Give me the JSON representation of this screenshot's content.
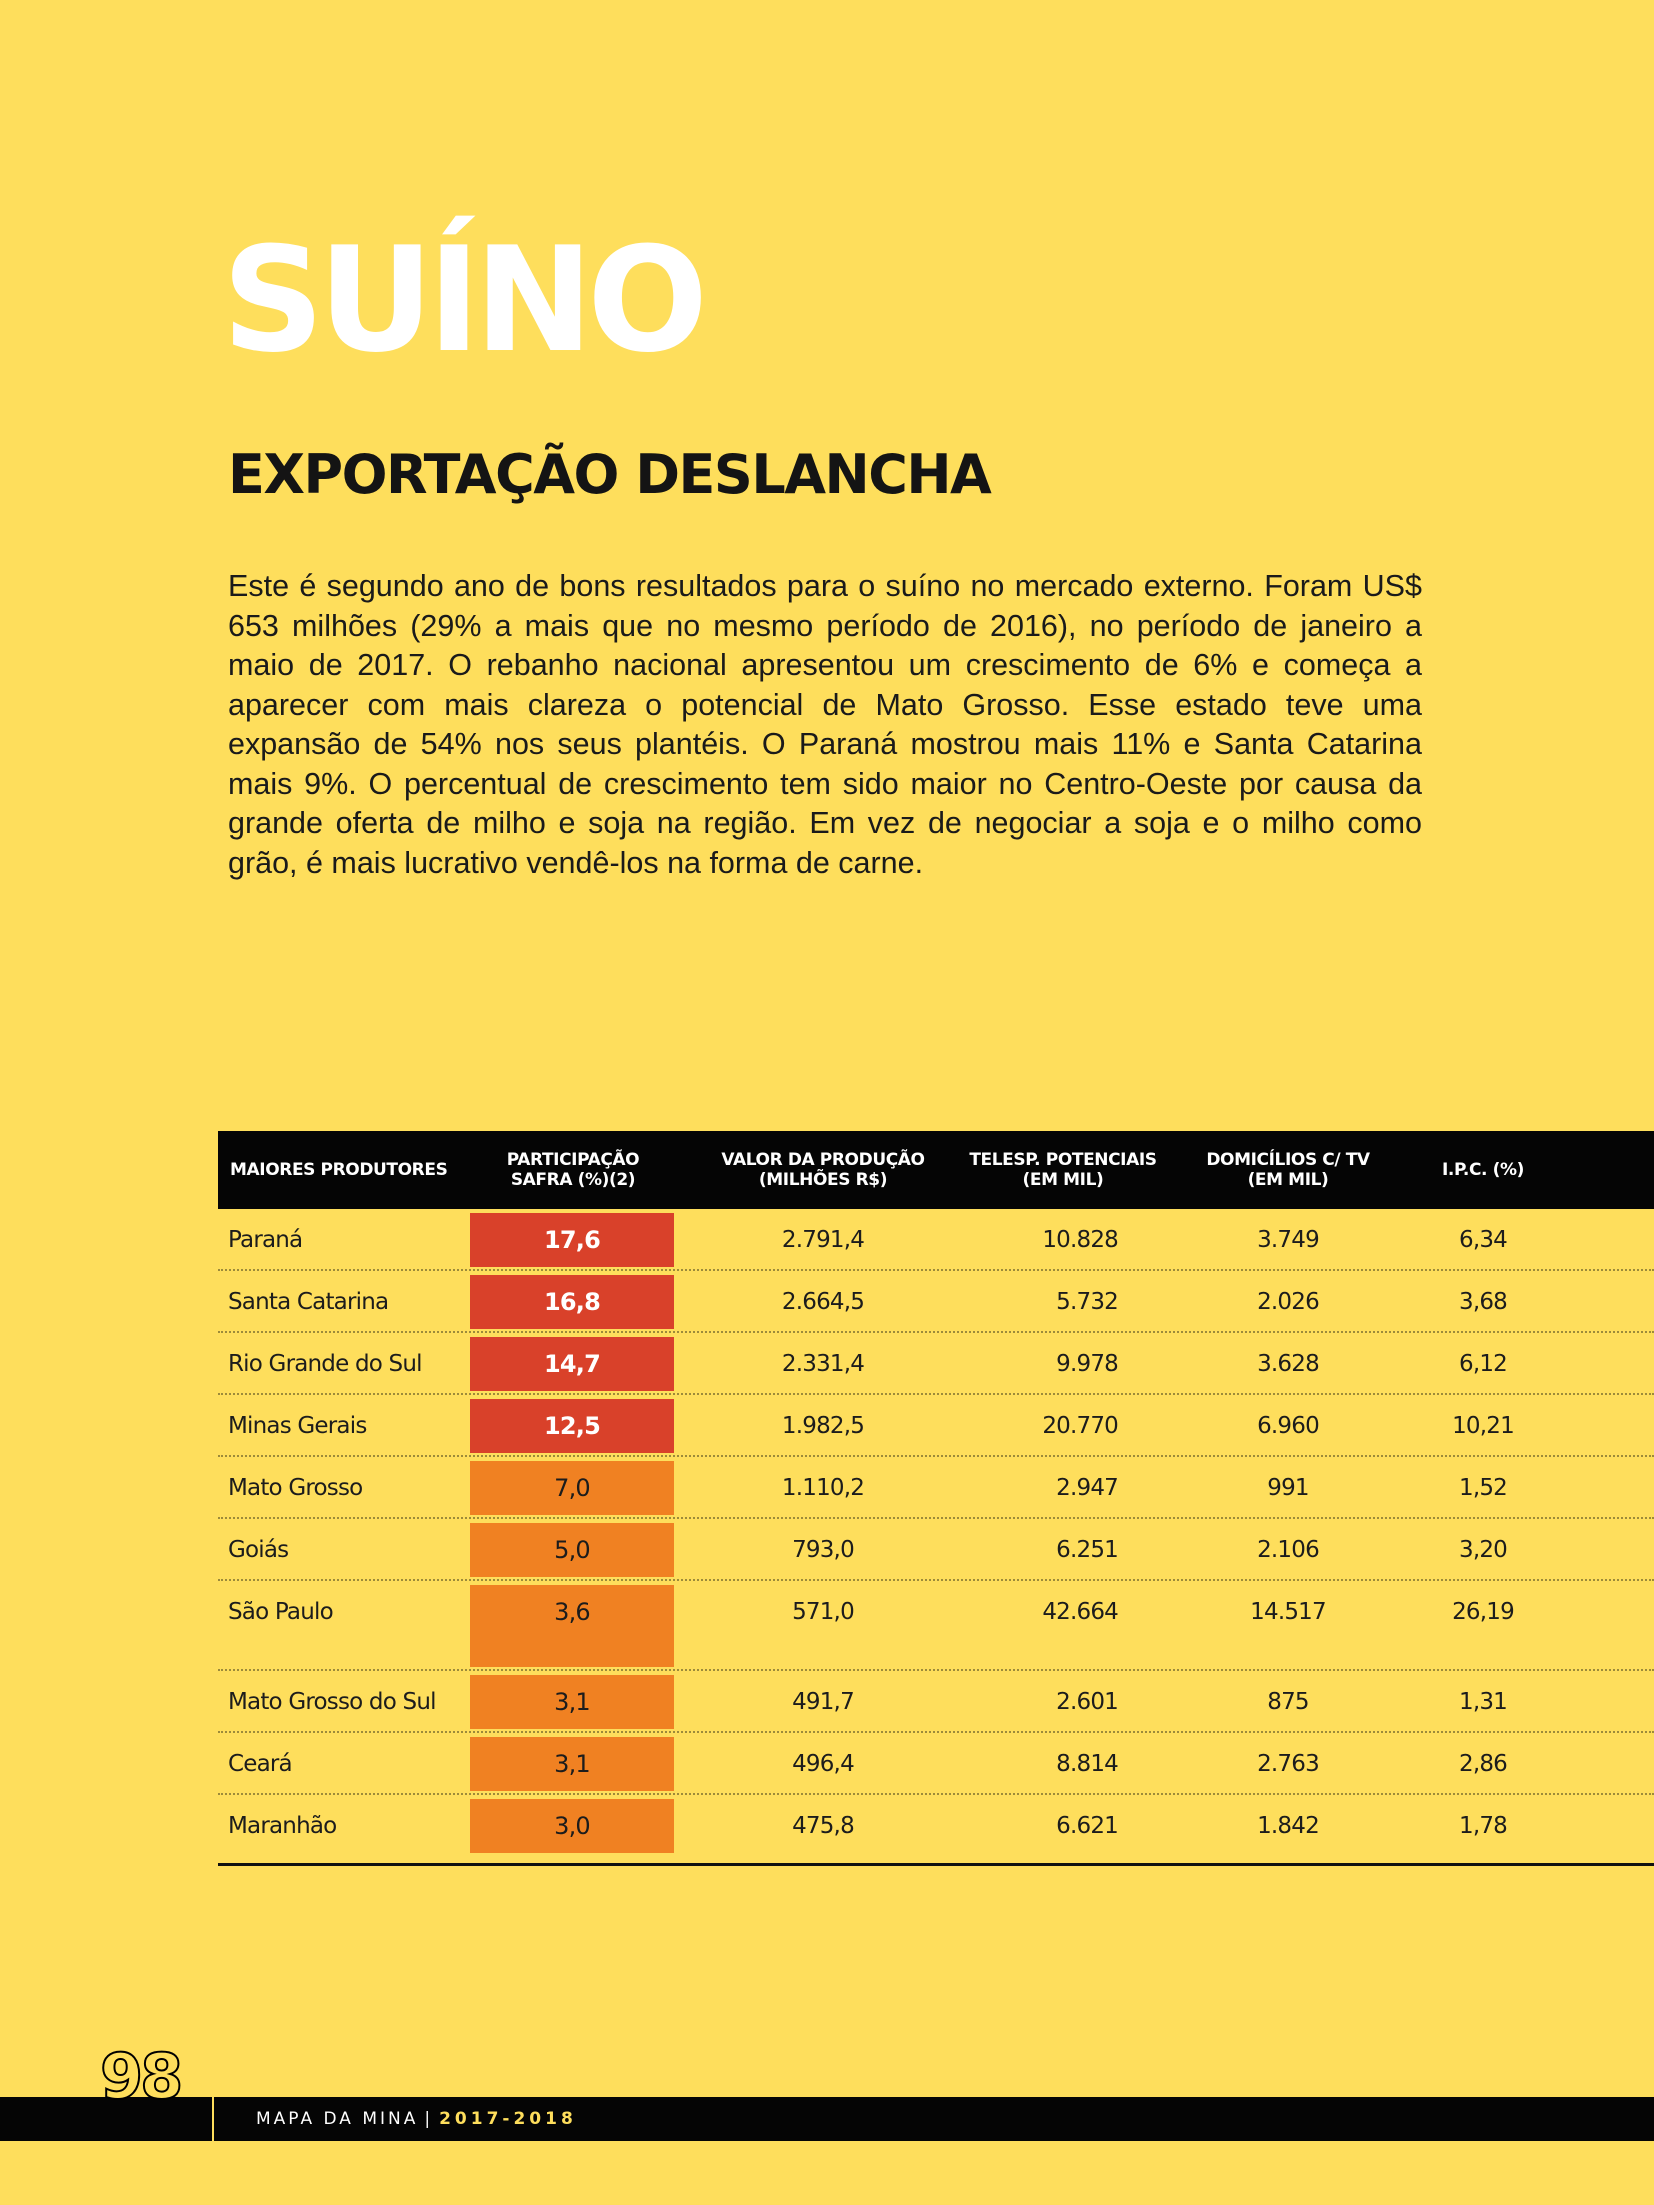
{
  "title": "SUÍNO",
  "subtitle": "EXPORTAÇÃO DESLANCHA",
  "body": "Este é segundo ano de bons resultados para o suíno no mercado externo. Foram US$ 653 milhões (29% a mais que no mesmo período de 2016), no período de janeiro a maio de 2017. O rebanho nacional apresentou um crescimento de 6% e começa a aparecer com mais clareza o potencial de Mato Grosso. Esse estado teve uma expansão de 54% nos seus plantéis. O Paraná mostrou mais 11% e Santa Catarina mais 9%. O percentual de crescimento tem sido maior no Centro-Oeste por causa da grande oferta de milho e soja na região. Em vez de negociar a soja e o milho como grão, é mais lucrativo vendê-los na forma de carne.",
  "table": {
    "headers": [
      "MAIORES PRODUTORES",
      "PARTICIPAÇÃO\nSAFRA (%)(2)",
      "VALOR DA PRODUÇÃO\n(MILHÕES R$)",
      "TELESP. POTENCIAIS\n(EM MIL)",
      "DOMICÍLIOS C/ TV\n(EM MIL)",
      "I.P.C. (%)"
    ],
    "rows": [
      {
        "state": "Paraná",
        "share": "17,6",
        "value": "2.791,4",
        "telesp": "10.828",
        "tv": "3.749",
        "ipc": "6,34",
        "tier": "red"
      },
      {
        "state": "Santa Catarina",
        "share": "16,8",
        "value": "2.664,5",
        "telesp": "5.732",
        "tv": "2.026",
        "ipc": "3,68",
        "tier": "red"
      },
      {
        "state": "Rio Grande do Sul",
        "share": "14,7",
        "value": "2.331,4",
        "telesp": "9.978",
        "tv": "3.628",
        "ipc": "6,12",
        "tier": "red"
      },
      {
        "state": "Minas Gerais",
        "share": "12,5",
        "value": "1.982,5",
        "telesp": "20.770",
        "tv": "6.960",
        "ipc": "10,21",
        "tier": "red"
      },
      {
        "state": "Mato Grosso",
        "share": "7,0",
        "value": "1.110,2",
        "telesp": "2.947",
        "tv": "991",
        "ipc": "1,52",
        "tier": "orange"
      },
      {
        "state": "Goiás",
        "share": "5,0",
        "value": "793,0",
        "telesp": "6.251",
        "tv": "2.106",
        "ipc": "3,20",
        "tier": "orange"
      },
      {
        "state": "São Paulo",
        "share": "3,6",
        "value": "571,0",
        "telesp": "42.664",
        "tv": "14.517",
        "ipc": "26,19",
        "tier": "orange"
      },
      {
        "state": "Mato Grosso do Sul",
        "share": "3,1",
        "value": "491,7",
        "telesp": "2.601",
        "tv": "875",
        "ipc": "1,31",
        "tier": "orange"
      },
      {
        "state": "Ceará",
        "share": "3,1",
        "value": "496,4",
        "telesp": "8.814",
        "tv": "2.763",
        "ipc": "2,86",
        "tier": "orange"
      },
      {
        "state": "Maranhão",
        "share": "3,0",
        "value": "475,8",
        "telesp": "6.621",
        "tv": "1.842",
        "ipc": "1,78",
        "tier": "orange"
      }
    ]
  },
  "footer": {
    "page_number": "98",
    "publication": "MAPA DA MINA",
    "separator": "|",
    "year": "2017-2018"
  },
  "colors": {
    "background": "#fede5c",
    "header_bar": "#050505",
    "badge_red": "#d9412a",
    "badge_orange": "#f08122"
  }
}
